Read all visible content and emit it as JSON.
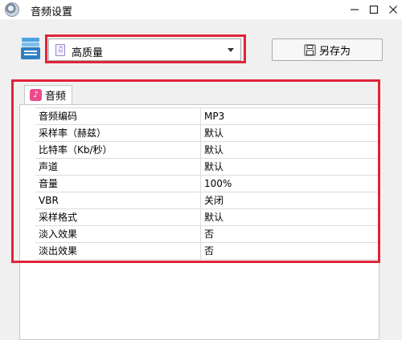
{
  "window": {
    "title": "音频设置"
  },
  "toolbar": {
    "preset_value": "高质量",
    "save_as_label": "另存为"
  },
  "tab": {
    "label": "音频"
  },
  "properties": [
    {
      "name": "音频编码",
      "value": "MP3"
    },
    {
      "name": "采样率（赫兹）",
      "value": "默认"
    },
    {
      "name": "比特率（Kb/秒）",
      "value": "默认"
    },
    {
      "name": "声道",
      "value": "默认"
    },
    {
      "name": "音量",
      "value": "100%"
    },
    {
      "name": "VBR",
      "value": "关闭"
    },
    {
      "name": "采样格式",
      "value": "默认"
    },
    {
      "name": "淡入效果",
      "value": "否"
    },
    {
      "name": "淡出效果",
      "value": "否"
    }
  ],
  "colors": {
    "highlight": "#e0233a",
    "tab_icon": "#ec4c8d"
  },
  "icons": [
    "app-icon",
    "minimize-icon",
    "maximize-icon",
    "close-icon",
    "preset-list-icon",
    "audio-file-icon",
    "dropdown-arrow-icon",
    "save-disk-icon",
    "music-note-icon"
  ]
}
